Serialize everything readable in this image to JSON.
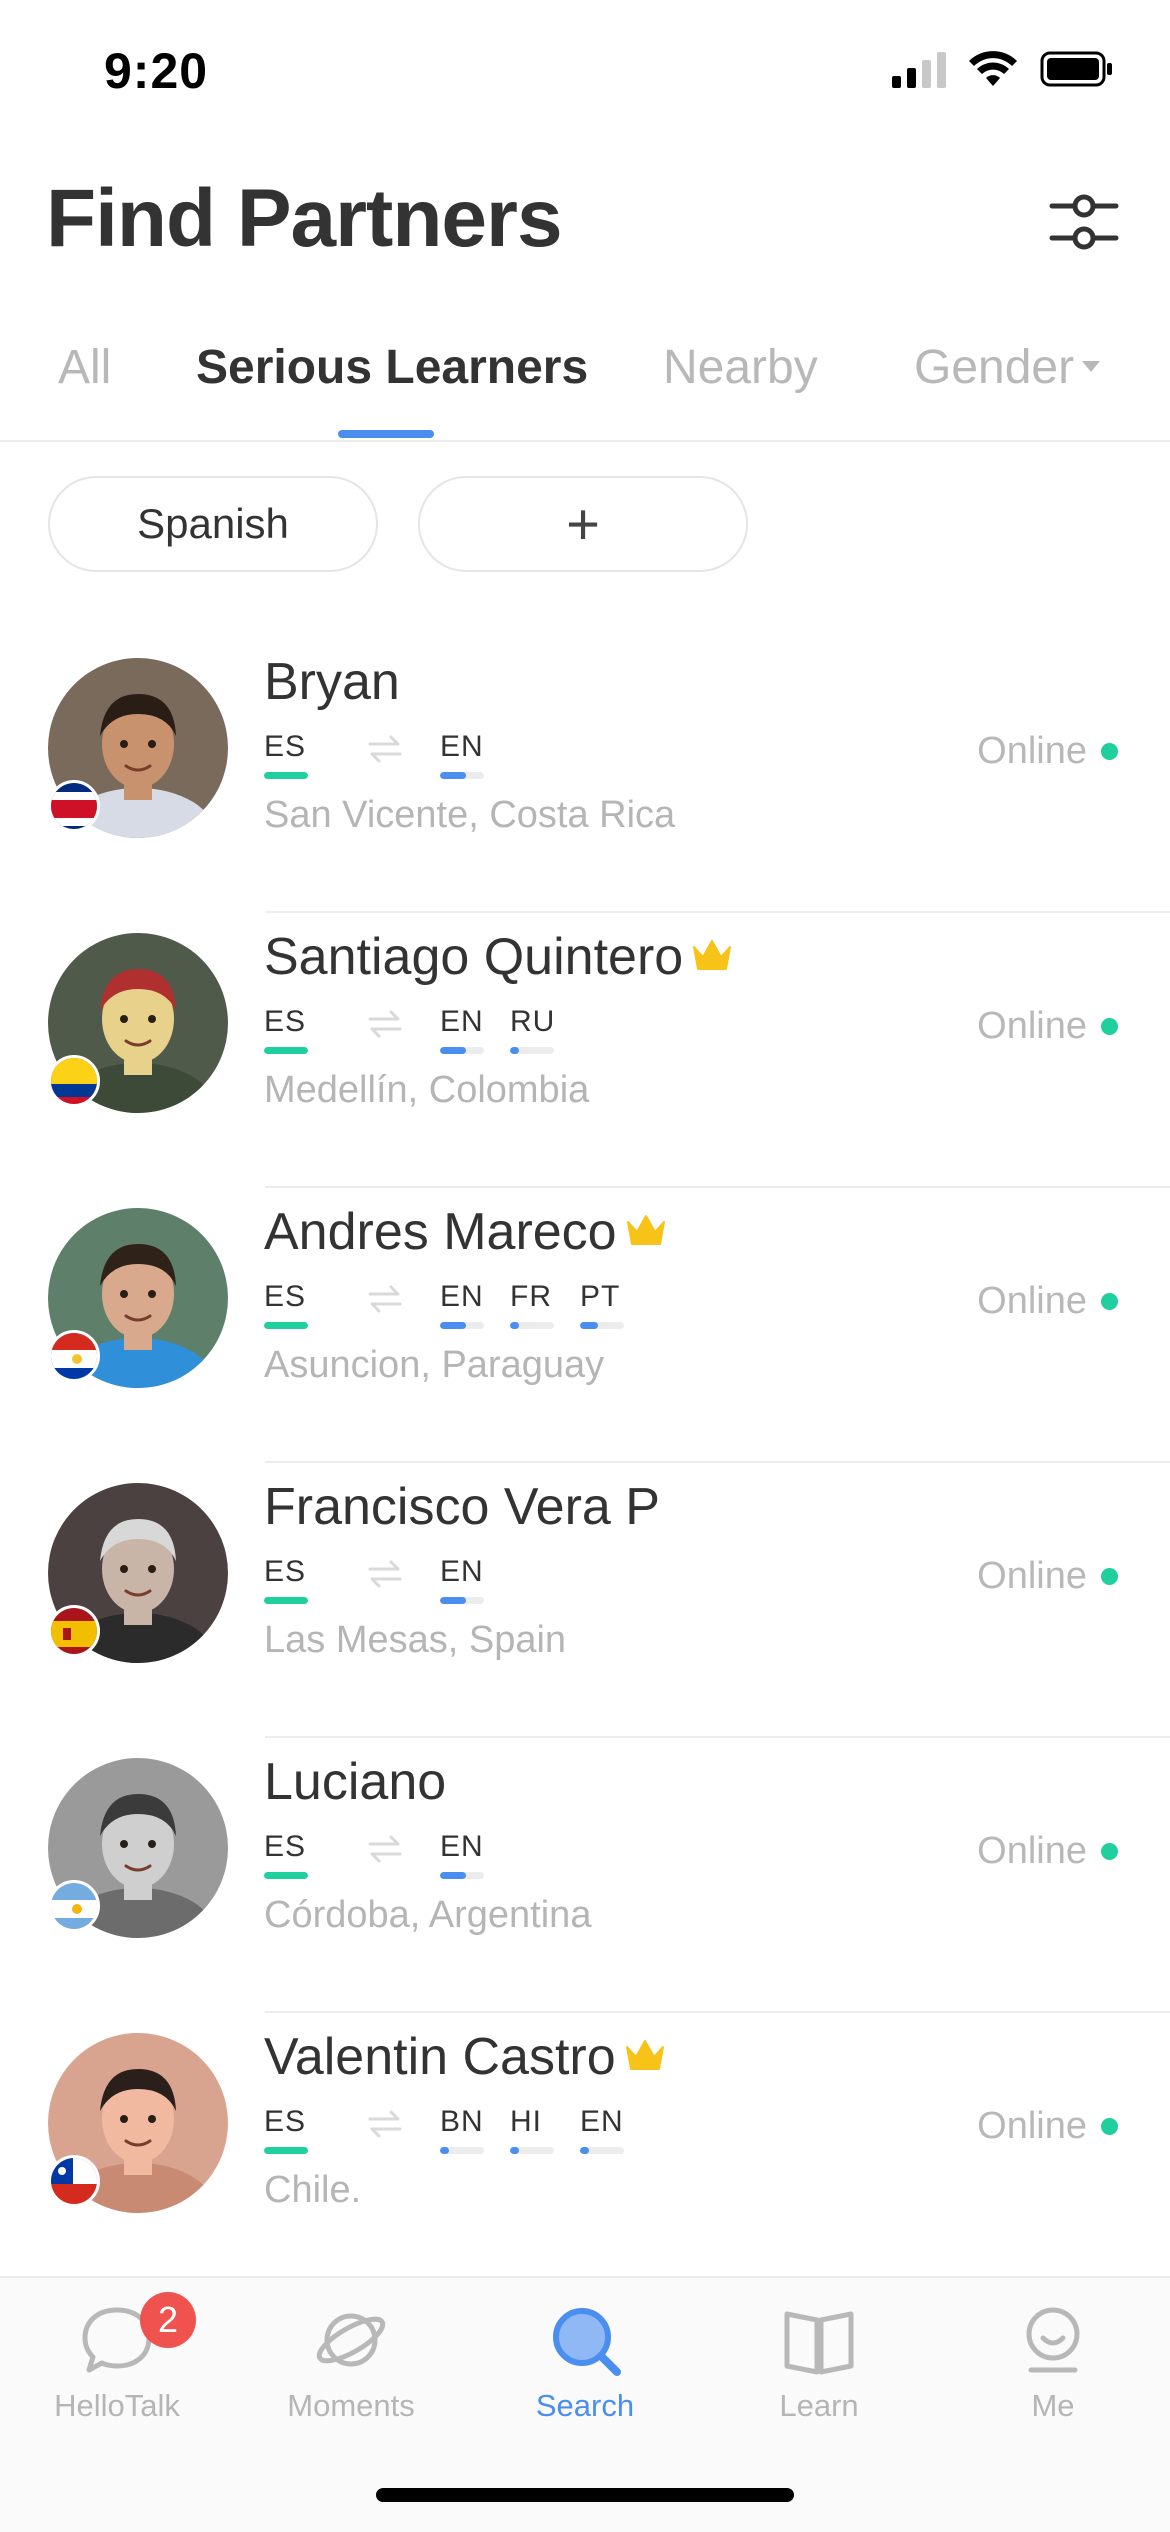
{
  "status_bar": {
    "time": "9:20"
  },
  "header": {
    "title": "Find Partners",
    "filter_icon": "sliders-icon"
  },
  "tabs": [
    {
      "label": "All",
      "active": false
    },
    {
      "label": "Serious Learners",
      "active": true
    },
    {
      "label": "Nearby",
      "active": false
    },
    {
      "label": "Gender",
      "active": false,
      "has_dropdown": true
    }
  ],
  "chips": {
    "language": "Spanish",
    "add": "+"
  },
  "colors": {
    "accent": "#4a8ef0",
    "native_bar": "#1fcf9e",
    "learning_bar": "#4a8ef0",
    "online_dot": "#1fcf9e",
    "crown": "#f7c318",
    "badge": "#f0524f"
  },
  "partners": [
    {
      "name": "Bryan",
      "vip": false,
      "flag": "costa-rica",
      "native": {
        "code": "ES",
        "level": 1.0
      },
      "learning": [
        {
          "code": "EN",
          "level": 0.6
        }
      ],
      "location": "San Vicente, Costa Rica",
      "status": "Online"
    },
    {
      "name": "Santiago Quintero",
      "vip": true,
      "flag": "colombia",
      "native": {
        "code": "ES",
        "level": 1.0
      },
      "learning": [
        {
          "code": "EN",
          "level": 0.6
        },
        {
          "code": "RU",
          "level": 0.2
        }
      ],
      "location": "Medellín, Colombia",
      "status": "Online"
    },
    {
      "name": "Andres Mareco",
      "vip": true,
      "flag": "paraguay",
      "native": {
        "code": "ES",
        "level": 1.0
      },
      "learning": [
        {
          "code": "EN",
          "level": 0.6
        },
        {
          "code": "FR",
          "level": 0.2
        },
        {
          "code": "PT",
          "level": 0.4
        }
      ],
      "location": "Asuncion, Paraguay",
      "status": "Online"
    },
    {
      "name": "Francisco Vera P",
      "vip": false,
      "flag": "spain",
      "native": {
        "code": "ES",
        "level": 1.0
      },
      "learning": [
        {
          "code": "EN",
          "level": 0.6
        }
      ],
      "location": "Las Mesas, Spain",
      "status": "Online"
    },
    {
      "name": "Luciano",
      "vip": false,
      "flag": "argentina",
      "native": {
        "code": "ES",
        "level": 1.0
      },
      "learning": [
        {
          "code": "EN",
          "level": 0.6
        }
      ],
      "location": "Córdoba, Argentina",
      "status": "Online"
    },
    {
      "name": "Valentin Castro",
      "vip": true,
      "flag": "chile",
      "native": {
        "code": "ES",
        "level": 1.0
      },
      "learning": [
        {
          "code": "BN",
          "level": 0.2
        },
        {
          "code": "HI",
          "level": 0.2
        },
        {
          "code": "EN",
          "level": 0.2
        }
      ],
      "location": "Chile.",
      "status": "Online"
    }
  ],
  "bottom_nav": {
    "items": [
      {
        "label": "HelloTalk",
        "icon": "chat-bubble-icon",
        "badge": "2",
        "active": false
      },
      {
        "label": "Moments",
        "icon": "planet-icon",
        "active": false
      },
      {
        "label": "Search",
        "icon": "search-icon",
        "active": true
      },
      {
        "label": "Learn",
        "icon": "book-icon",
        "active": false
      },
      {
        "label": "Me",
        "icon": "profile-icon",
        "active": false
      }
    ]
  }
}
